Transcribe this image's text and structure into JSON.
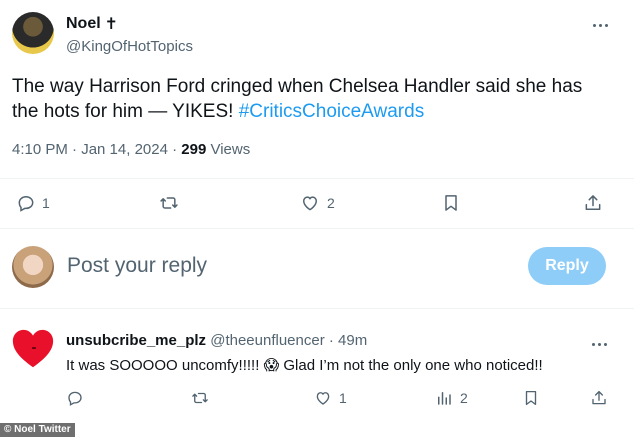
{
  "tweet": {
    "author_name": "Noel",
    "author_glyph": "✝",
    "author_handle": "@KingOfHotTopics",
    "text_main": "The way Harrison Ford cringed when Chelsea Handler said she has the hots for him — YIKES! ",
    "hashtag": "#CriticsChoiceAwards",
    "timestamp": "4:10 PM · Jan 14, 2024 · ",
    "views_count": "299",
    "views_label": " Views",
    "replies_count": "1",
    "likes_count": "2"
  },
  "reply_box": {
    "placeholder": "Post your reply",
    "button_label": "Reply"
  },
  "reply": {
    "author_name": "unsubcribe_me_plz",
    "author_handle": "@theeunfluencer",
    "age": " · 49m",
    "text": "It was SOOOOO uncomfy!!!!! 😱 Glad I’m not the only one who noticed!!",
    "replies_count": "",
    "retweets_count": "",
    "likes_count": "1",
    "views_count": "2"
  },
  "credit": "© Noel Twitter",
  "colors": {
    "accent": "#1d9bf0",
    "reply_button_disabled": "#8ecdf8",
    "heart": "#e8102a"
  }
}
